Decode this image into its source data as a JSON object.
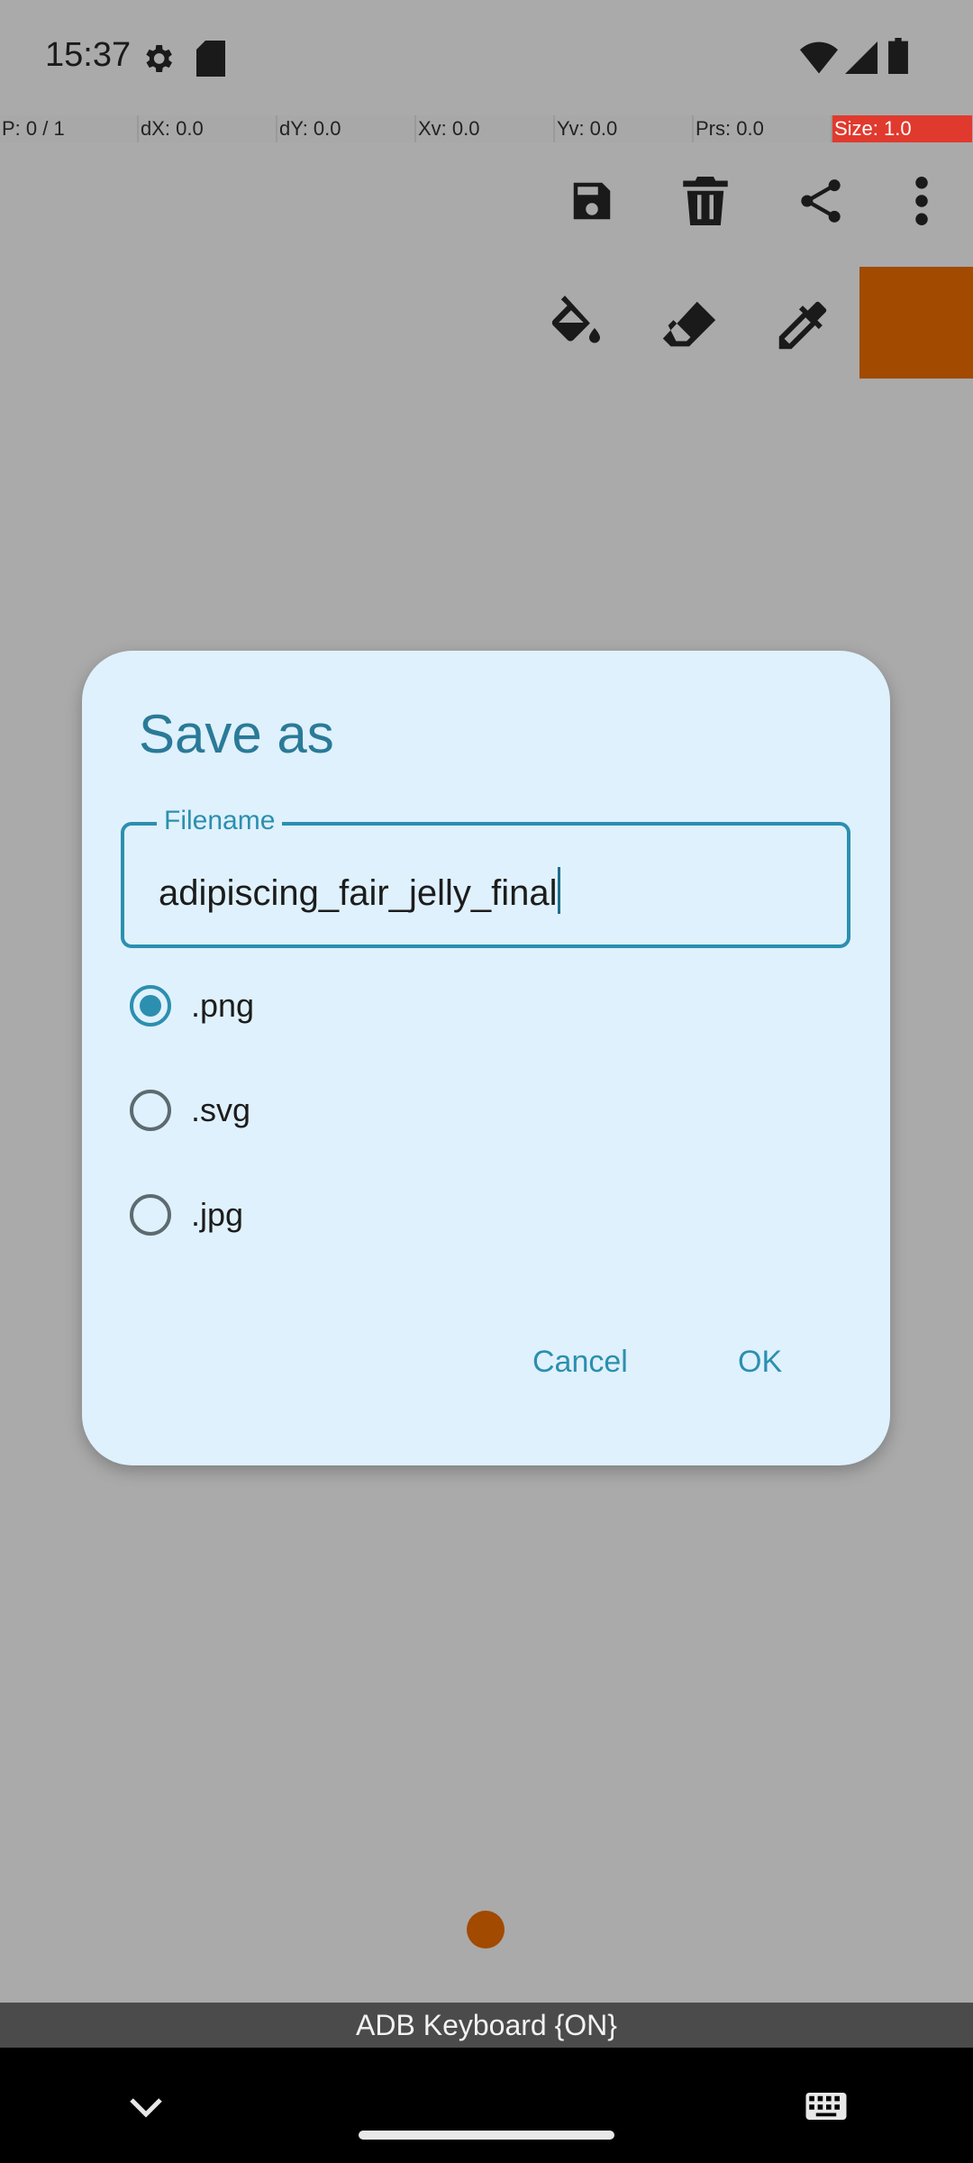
{
  "status_bar": {
    "time": "15:37"
  },
  "pointer_bar": {
    "cells": [
      "P: 0 / 1",
      "dX: 0.0",
      "dY: 0.0",
      "Xv: 0.0",
      "Yv: 0.0",
      "Prs: 0.0",
      "Size: 1.0"
    ]
  },
  "colors": {
    "accent": "#2b8fb0",
    "dialog_bg": "#dff1fc",
    "brush": "#a14a00",
    "size_cell": "#e03a2e"
  },
  "dialog": {
    "title": "Save as",
    "filename_label": "Filename",
    "filename_value": "adipiscing_fair_jelly_final",
    "options": [
      {
        "label": ".png",
        "checked": true
      },
      {
        "label": ".svg",
        "checked": false
      },
      {
        "label": ".jpg",
        "checked": false
      }
    ],
    "cancel_label": "Cancel",
    "ok_label": "OK"
  },
  "keyboard_bar": {
    "label": "ADB Keyboard {ON}"
  }
}
